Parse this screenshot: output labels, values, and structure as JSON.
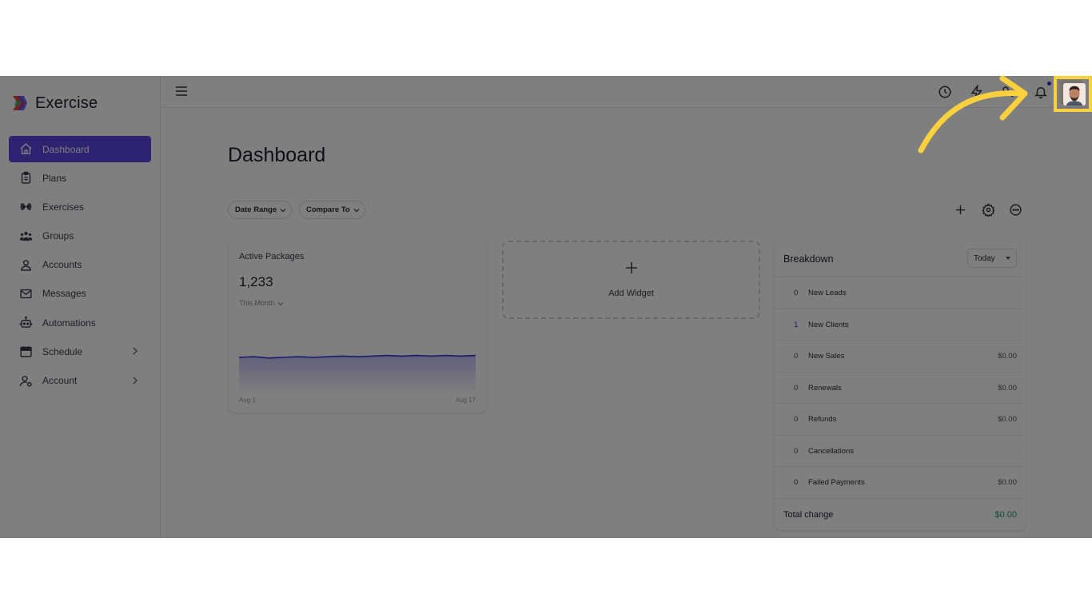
{
  "brand": {
    "name": "Exercise"
  },
  "sidebar": {
    "items": [
      {
        "label": "Dashboard",
        "icon": "home-icon",
        "active": true
      },
      {
        "label": "Plans",
        "icon": "clipboard-icon"
      },
      {
        "label": "Exercises",
        "icon": "dumbbell-icon"
      },
      {
        "label": "Groups",
        "icon": "users-icon"
      },
      {
        "label": "Accounts",
        "icon": "user-icon"
      },
      {
        "label": "Messages",
        "icon": "mail-icon"
      },
      {
        "label": "Automations",
        "icon": "robot-icon"
      },
      {
        "label": "Schedule",
        "icon": "calendar-icon",
        "expandable": true
      },
      {
        "label": "Account",
        "icon": "user-settings-icon",
        "expandable": true
      }
    ]
  },
  "topbar": {
    "icons": [
      "history-icon",
      "bolt-icon",
      "key-icon",
      "bell-icon"
    ],
    "accent": "#3b32d6"
  },
  "main": {
    "title": "Dashboard",
    "filters": {
      "date_range": "Date Range",
      "compare_to": "Compare To"
    },
    "tools": [
      "plus-icon",
      "gear-icon",
      "more-icon"
    ]
  },
  "active_packages": {
    "title": "Active Packages",
    "value": "1,233",
    "period": "This Month",
    "x_start": "Aug 1",
    "x_end": "Aug 17",
    "line_color": "#3b32d6",
    "trend": [
      0.55,
      0.56,
      0.54,
      0.55,
      0.56,
      0.55,
      0.56,
      0.57,
      0.56,
      0.57,
      0.58,
      0.57,
      0.58,
      0.57,
      0.58,
      0.57,
      0.58
    ]
  },
  "add_widget": {
    "label": "Add Widget"
  },
  "breakdown": {
    "title": "Breakdown",
    "period": "Today",
    "rows": [
      {
        "count": "0",
        "label": "New Leads",
        "amount": ""
      },
      {
        "count": "1",
        "label": "New Clients",
        "amount": ""
      },
      {
        "count": "0",
        "label": "New Sales",
        "amount": "$0.00"
      },
      {
        "count": "0",
        "label": "Renewals",
        "amount": "$0.00"
      },
      {
        "count": "0",
        "label": "Refunds",
        "amount": "$0.00"
      },
      {
        "count": "0",
        "label": "Cancellations",
        "amount": ""
      },
      {
        "count": "0",
        "label": "Failed Payments",
        "amount": "$0.00"
      }
    ],
    "total_label": "Total change",
    "total_amount": "$0.00",
    "total_color": "#1a9c6a"
  },
  "annotation": {
    "highlight_color": "#f9d13e"
  }
}
